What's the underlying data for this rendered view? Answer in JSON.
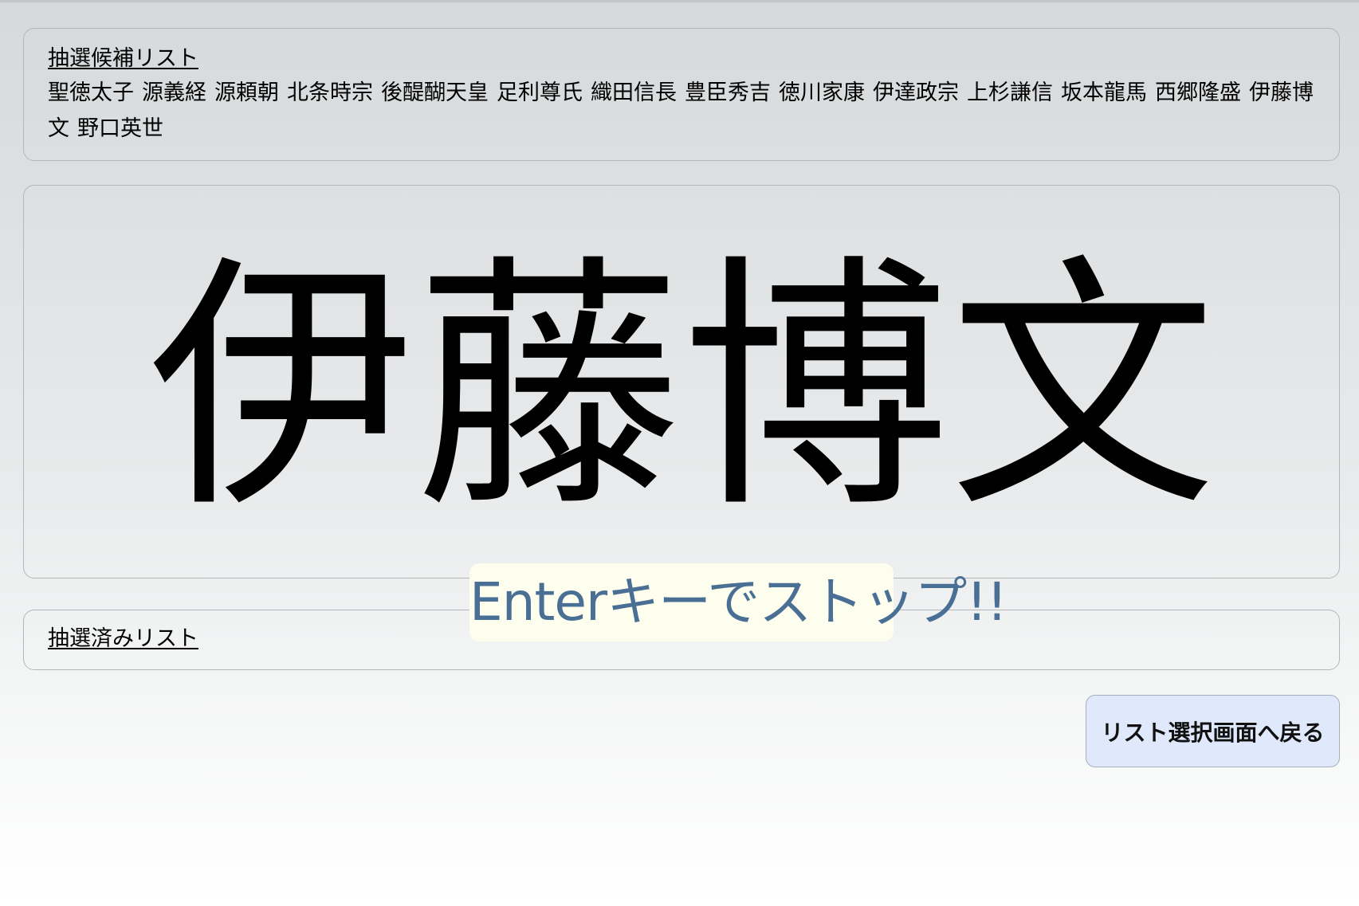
{
  "candidate_list": {
    "heading": "抽選候補リスト",
    "names": [
      "聖徳太子",
      "源義経",
      "源頼朝",
      "北条時宗",
      "後醍醐天皇",
      "足利尊氏",
      "織田信長",
      "豊臣秀吉",
      "徳川家康",
      "伊達政宗",
      "上杉謙信",
      "坂本龍馬",
      "西郷隆盛",
      "伊藤博文",
      "野口英世"
    ]
  },
  "draw": {
    "current_name": "伊藤博文"
  },
  "hint": {
    "text": "Enterキーでストップ!!"
  },
  "drawn_list": {
    "heading": "抽選済みリスト",
    "names": []
  },
  "back_button": {
    "label": "リスト選択画面へ戻る"
  },
  "colors": {
    "hint_text": "#4a6f94",
    "hint_background": "#fefeee",
    "button_background": "#dfe9fb"
  }
}
